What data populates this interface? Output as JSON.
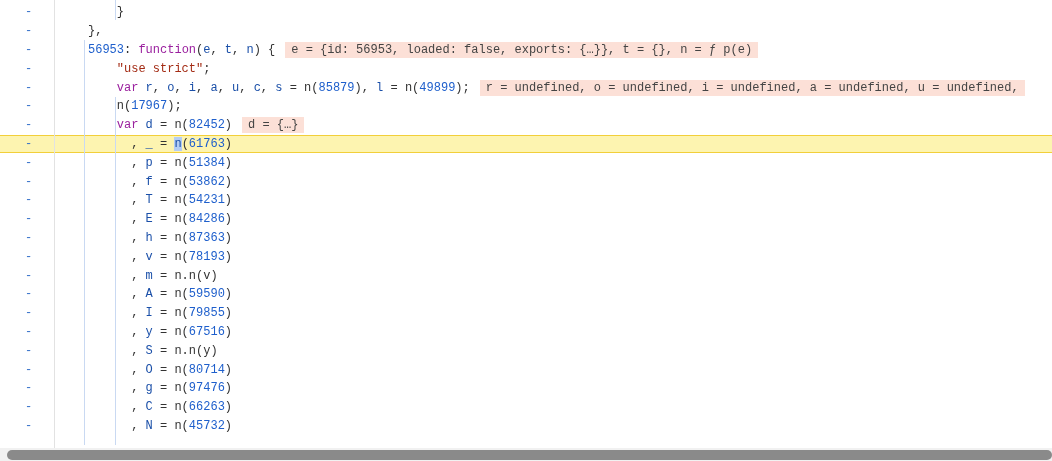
{
  "lines": [
    {
      "gutter": "-",
      "highlighted": false,
      "tokens": [
        {
          "kind": "plain",
          "text": "    }"
        }
      ]
    },
    {
      "gutter": "-",
      "highlighted": false,
      "tokens": [
        {
          "kind": "plain",
          "text": "},"
        }
      ]
    },
    {
      "gutter": "-",
      "highlighted": false,
      "tokens": [
        {
          "kind": "prop",
          "text": "56953"
        },
        {
          "kind": "plain",
          "text": ": "
        },
        {
          "kind": "kw",
          "text": "function"
        },
        {
          "kind": "plain",
          "text": "("
        },
        {
          "kind": "def",
          "text": "e"
        },
        {
          "kind": "plain",
          "text": ", "
        },
        {
          "kind": "def",
          "text": "t"
        },
        {
          "kind": "plain",
          "text": ", "
        },
        {
          "kind": "def",
          "text": "n"
        },
        {
          "kind": "plain",
          "text": ") {"
        }
      ],
      "annotation": "e = {id: 56953, loaded: false, exports: {…}}, t = {}, n = ƒ p(e)"
    },
    {
      "gutter": "-",
      "highlighted": false,
      "tokens": [
        {
          "kind": "str",
          "text": "    \"use strict\""
        },
        {
          "kind": "plain",
          "text": ";"
        }
      ]
    },
    {
      "gutter": "-",
      "highlighted": false,
      "tokens": [
        {
          "kind": "kw",
          "text": "    var "
        },
        {
          "kind": "def",
          "text": "r"
        },
        {
          "kind": "plain",
          "text": ", "
        },
        {
          "kind": "def",
          "text": "o"
        },
        {
          "kind": "plain",
          "text": ", "
        },
        {
          "kind": "def",
          "text": "i"
        },
        {
          "kind": "plain",
          "text": ", "
        },
        {
          "kind": "def",
          "text": "a"
        },
        {
          "kind": "plain",
          "text": ", "
        },
        {
          "kind": "def",
          "text": "u"
        },
        {
          "kind": "plain",
          "text": ", "
        },
        {
          "kind": "def",
          "text": "c"
        },
        {
          "kind": "plain",
          "text": ", "
        },
        {
          "kind": "def",
          "text": "s"
        },
        {
          "kind": "plain",
          "text": " = n("
        },
        {
          "kind": "num",
          "text": "85879"
        },
        {
          "kind": "plain",
          "text": "), "
        },
        {
          "kind": "def",
          "text": "l"
        },
        {
          "kind": "plain",
          "text": " = n("
        },
        {
          "kind": "num",
          "text": "49899"
        },
        {
          "kind": "plain",
          "text": ");"
        }
      ],
      "annotation": "r = undefined, o = undefined, i = undefined, a = undefined, u = undefined,"
    },
    {
      "gutter": "-",
      "highlighted": false,
      "tokens": [
        {
          "kind": "plain",
          "text": "    n("
        },
        {
          "kind": "num",
          "text": "17967"
        },
        {
          "kind": "plain",
          "text": ");"
        }
      ]
    },
    {
      "gutter": "-",
      "highlighted": false,
      "tokens": [
        {
          "kind": "kw",
          "text": "    var "
        },
        {
          "kind": "def",
          "text": "d"
        },
        {
          "kind": "plain",
          "text": " = n("
        },
        {
          "kind": "num",
          "text": "82452"
        },
        {
          "kind": "plain",
          "text": ")"
        }
      ],
      "annotation": "d = {…}"
    },
    {
      "gutter": "-",
      "highlighted": true,
      "tokens": [
        {
          "kind": "plain",
          "text": "      , "
        },
        {
          "kind": "def",
          "text": "_"
        },
        {
          "kind": "plain",
          "text": " = "
        },
        {
          "kind": "selected",
          "text": "n"
        },
        {
          "kind": "plain",
          "text": "("
        },
        {
          "kind": "num",
          "text": "61763"
        },
        {
          "kind": "plain",
          "text": ")"
        }
      ]
    },
    {
      "gutter": "-",
      "highlighted": false,
      "tokens": [
        {
          "kind": "plain",
          "text": "      , "
        },
        {
          "kind": "def",
          "text": "p"
        },
        {
          "kind": "plain",
          "text": " = n("
        },
        {
          "kind": "num",
          "text": "51384"
        },
        {
          "kind": "plain",
          "text": ")"
        }
      ]
    },
    {
      "gutter": "-",
      "highlighted": false,
      "tokens": [
        {
          "kind": "plain",
          "text": "      , "
        },
        {
          "kind": "def",
          "text": "f"
        },
        {
          "kind": "plain",
          "text": " = n("
        },
        {
          "kind": "num",
          "text": "53862"
        },
        {
          "kind": "plain",
          "text": ")"
        }
      ]
    },
    {
      "gutter": "-",
      "highlighted": false,
      "tokens": [
        {
          "kind": "plain",
          "text": "      , "
        },
        {
          "kind": "def",
          "text": "T"
        },
        {
          "kind": "plain",
          "text": " = n("
        },
        {
          "kind": "num",
          "text": "54231"
        },
        {
          "kind": "plain",
          "text": ")"
        }
      ]
    },
    {
      "gutter": "-",
      "highlighted": false,
      "tokens": [
        {
          "kind": "plain",
          "text": "      , "
        },
        {
          "kind": "def",
          "text": "E"
        },
        {
          "kind": "plain",
          "text": " = n("
        },
        {
          "kind": "num",
          "text": "84286"
        },
        {
          "kind": "plain",
          "text": ")"
        }
      ]
    },
    {
      "gutter": "-",
      "highlighted": false,
      "tokens": [
        {
          "kind": "plain",
          "text": "      , "
        },
        {
          "kind": "def",
          "text": "h"
        },
        {
          "kind": "plain",
          "text": " = n("
        },
        {
          "kind": "num",
          "text": "87363"
        },
        {
          "kind": "plain",
          "text": ")"
        }
      ]
    },
    {
      "gutter": "-",
      "highlighted": false,
      "tokens": [
        {
          "kind": "plain",
          "text": "      , "
        },
        {
          "kind": "def",
          "text": "v"
        },
        {
          "kind": "plain",
          "text": " = n("
        },
        {
          "kind": "num",
          "text": "78193"
        },
        {
          "kind": "plain",
          "text": ")"
        }
      ]
    },
    {
      "gutter": "-",
      "highlighted": false,
      "tokens": [
        {
          "kind": "plain",
          "text": "      , "
        },
        {
          "kind": "def",
          "text": "m"
        },
        {
          "kind": "plain",
          "text": " = n.n(v)"
        }
      ]
    },
    {
      "gutter": "-",
      "highlighted": false,
      "tokens": [
        {
          "kind": "plain",
          "text": "      , "
        },
        {
          "kind": "def",
          "text": "A"
        },
        {
          "kind": "plain",
          "text": " = n("
        },
        {
          "kind": "num",
          "text": "59590"
        },
        {
          "kind": "plain",
          "text": ")"
        }
      ]
    },
    {
      "gutter": "-",
      "highlighted": false,
      "tokens": [
        {
          "kind": "plain",
          "text": "      , "
        },
        {
          "kind": "def",
          "text": "I"
        },
        {
          "kind": "plain",
          "text": " = n("
        },
        {
          "kind": "num",
          "text": "79855"
        },
        {
          "kind": "plain",
          "text": ")"
        }
      ]
    },
    {
      "gutter": "-",
      "highlighted": false,
      "tokens": [
        {
          "kind": "plain",
          "text": "      , "
        },
        {
          "kind": "def",
          "text": "y"
        },
        {
          "kind": "plain",
          "text": " = n("
        },
        {
          "kind": "num",
          "text": "67516"
        },
        {
          "kind": "plain",
          "text": ")"
        }
      ]
    },
    {
      "gutter": "-",
      "highlighted": false,
      "tokens": [
        {
          "kind": "plain",
          "text": "      , "
        },
        {
          "kind": "def",
          "text": "S"
        },
        {
          "kind": "plain",
          "text": " = n.n(y)"
        }
      ]
    },
    {
      "gutter": "-",
      "highlighted": false,
      "tokens": [
        {
          "kind": "plain",
          "text": "      , "
        },
        {
          "kind": "def",
          "text": "O"
        },
        {
          "kind": "plain",
          "text": " = n("
        },
        {
          "kind": "num",
          "text": "80714"
        },
        {
          "kind": "plain",
          "text": ")"
        }
      ]
    },
    {
      "gutter": "-",
      "highlighted": false,
      "tokens": [
        {
          "kind": "plain",
          "text": "      , "
        },
        {
          "kind": "def",
          "text": "g"
        },
        {
          "kind": "plain",
          "text": " = n("
        },
        {
          "kind": "num",
          "text": "97476"
        },
        {
          "kind": "plain",
          "text": ")"
        }
      ]
    },
    {
      "gutter": "-",
      "highlighted": false,
      "tokens": [
        {
          "kind": "plain",
          "text": "      , "
        },
        {
          "kind": "def",
          "text": "C"
        },
        {
          "kind": "plain",
          "text": " = n("
        },
        {
          "kind": "num",
          "text": "66263"
        },
        {
          "kind": "plain",
          "text": ")"
        }
      ]
    },
    {
      "gutter": "-",
      "highlighted": false,
      "tokens": [
        {
          "kind": "plain",
          "text": "      , "
        },
        {
          "kind": "def",
          "text": "N"
        },
        {
          "kind": "plain",
          "text": " = n("
        },
        {
          "kind": "num",
          "text": "45732"
        },
        {
          "kind": "plain",
          "text": ")"
        }
      ]
    }
  ]
}
